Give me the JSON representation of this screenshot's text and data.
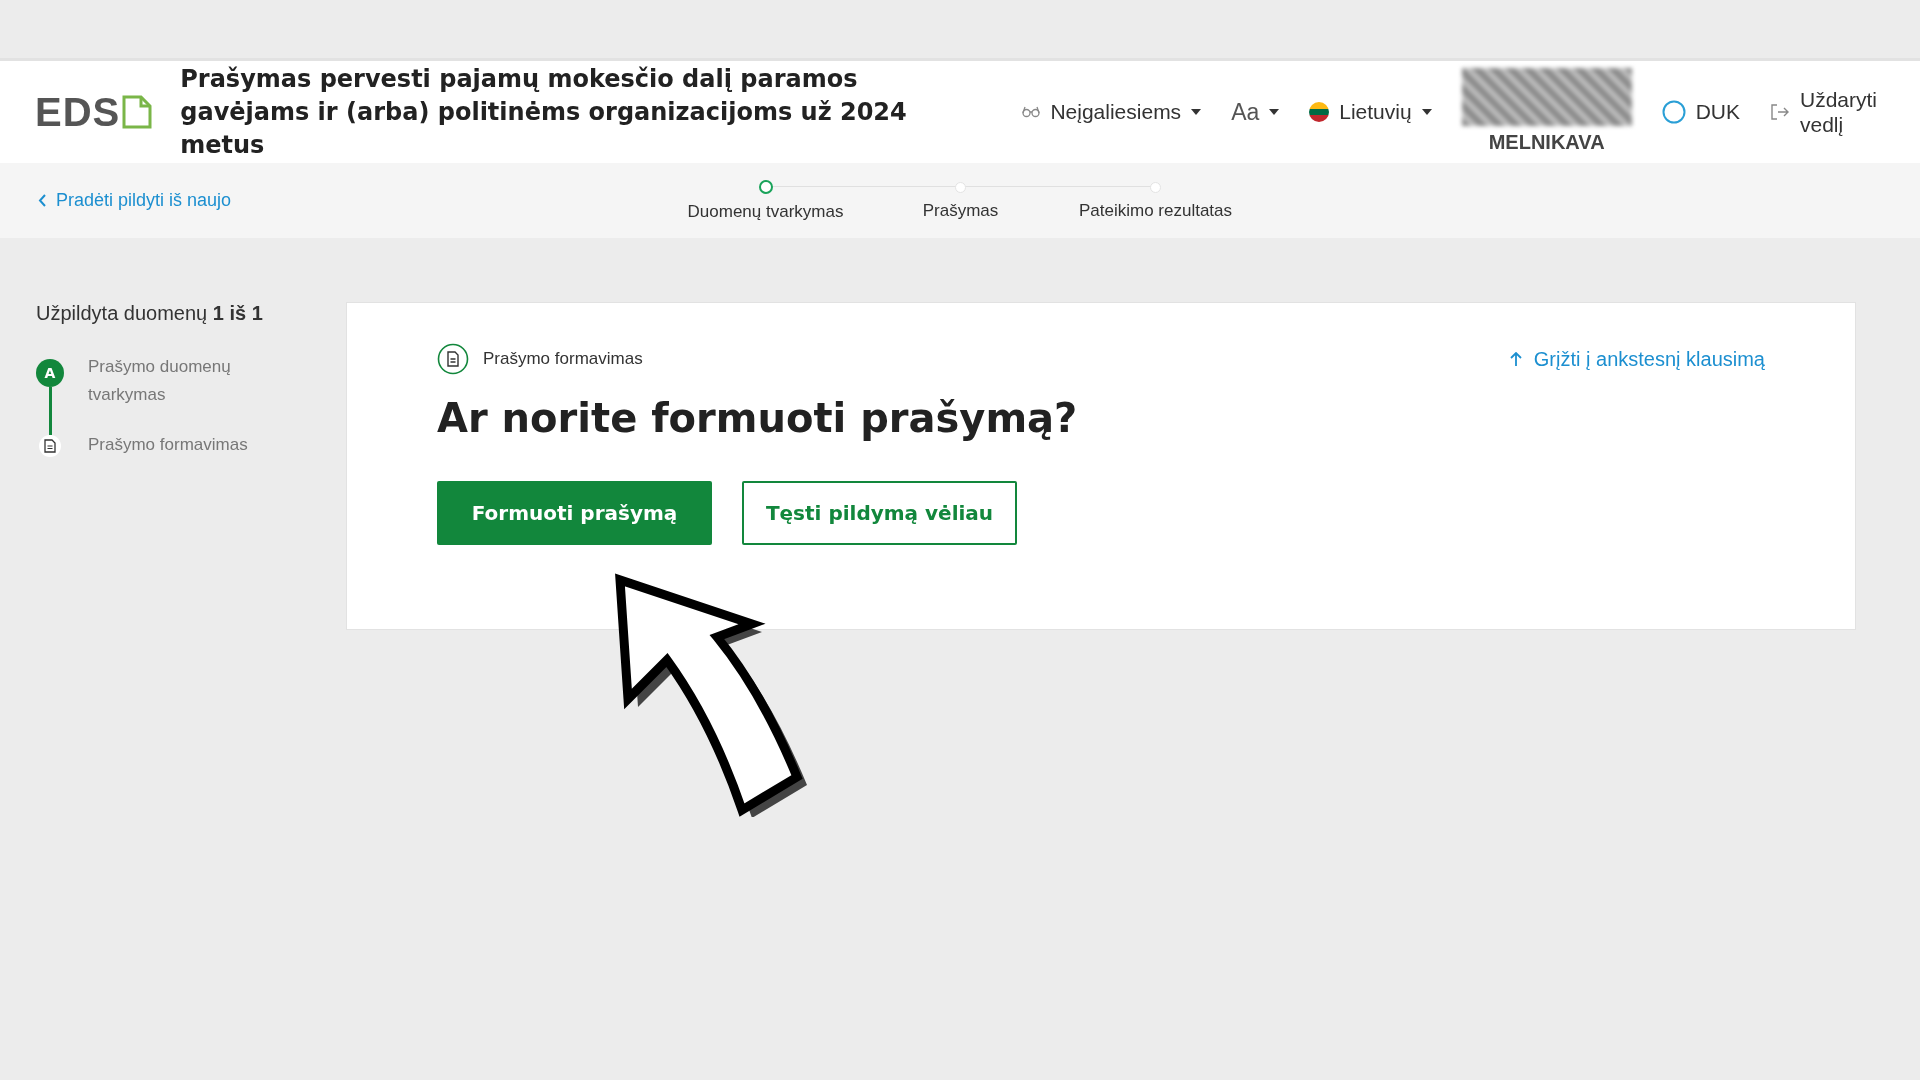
{
  "header": {
    "logo": "EDS",
    "title": "Prašymas pervesti pajamų mokesčio dalį paramos gavėjams ir (arba) politinėms organizacijoms už 2024 metus",
    "nav": [
      {
        "kind": "accessibility",
        "label": "Neįgaliesiems",
        "dropdown": true
      },
      {
        "kind": "font",
        "label": "Aa",
        "dropdown": true
      },
      {
        "kind": "language",
        "label": "Lietuvių",
        "dropdown": true
      },
      {
        "kind": "user",
        "label": "MELNIKAVA",
        "dropdown": false
      },
      {
        "kind": "help",
        "label": "DUK",
        "dropdown": false
      },
      {
        "kind": "exit",
        "label": "Uždaryti vedlį",
        "dropdown": false
      }
    ]
  },
  "subheader": {
    "back_link": "Pradėti pildyti iš naujo",
    "steps": [
      {
        "label": "Duomenų tvarkymas",
        "selected": true
      },
      {
        "label": "Prašymas",
        "selected": false
      },
      {
        "label": "Pateikimo rezultatas",
        "selected": false
      }
    ]
  },
  "sidebar": {
    "progress": "Užpildyta duomenų **1 iš 1**",
    "steps": [
      {
        "kind": "badge",
        "badge": "A",
        "label": "Prašymo duomenų tvarkymas"
      },
      {
        "kind": "document",
        "label": "Prašymo formavimas"
      }
    ]
  },
  "card": {
    "section": "Prašymo formavimas",
    "back_link": "Grįžti į ankstesnį klausimą",
    "question": "Ar norite formuoti prašymą?",
    "buttons": [
      {
        "kind": "primary",
        "label": "Formuoti prašymą"
      },
      {
        "kind": "secondary",
        "label": "Tęsti pildymą vėliau"
      }
    ]
  }
}
